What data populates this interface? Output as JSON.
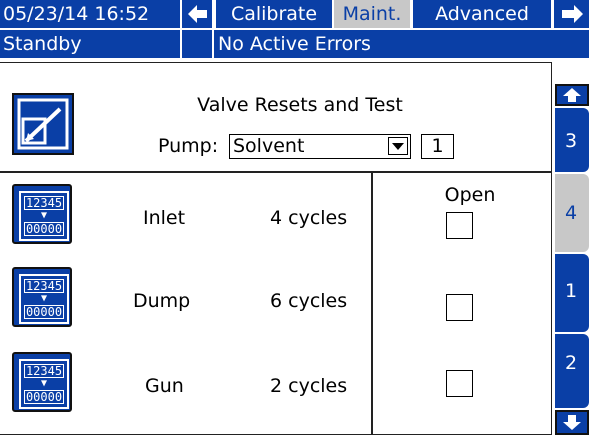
{
  "header": {
    "datetime": "05/23/14 16:52",
    "tabs": [
      {
        "label": "Calibrate",
        "active": false
      },
      {
        "label": "Maint.",
        "active": true
      },
      {
        "label": "Advanced",
        "active": false
      }
    ],
    "status": "Standby",
    "errors": "No Active Errors"
  },
  "panel": {
    "title": "Valve Resets and Test",
    "pump_label": "Pump:",
    "pump_value": "Solvent",
    "pump_number": "1",
    "open_header": "Open"
  },
  "valves": [
    {
      "name": "Inlet",
      "cycles": "4 cycles",
      "open": false,
      "counter_top": "12345",
      "counter_bottom": "00000"
    },
    {
      "name": "Dump",
      "cycles": "6 cycles",
      "open": false,
      "counter_top": "12345",
      "counter_bottom": "00000"
    },
    {
      "name": "Gun",
      "cycles": "2 cycles",
      "open": false,
      "counter_top": "12345",
      "counter_bottom": "00000"
    }
  ],
  "side_pages": [
    "3",
    "4",
    "1",
    "2"
  ],
  "active_side_page": "4",
  "colors": {
    "accent": "#0a3fa6",
    "selected_tab": "#c8c8c8"
  },
  "icons": [
    "left-arrow-icon",
    "right-arrow-icon",
    "up-arrow-icon",
    "down-arrow-icon",
    "edit-icon",
    "dropdown-arrow-icon"
  ]
}
